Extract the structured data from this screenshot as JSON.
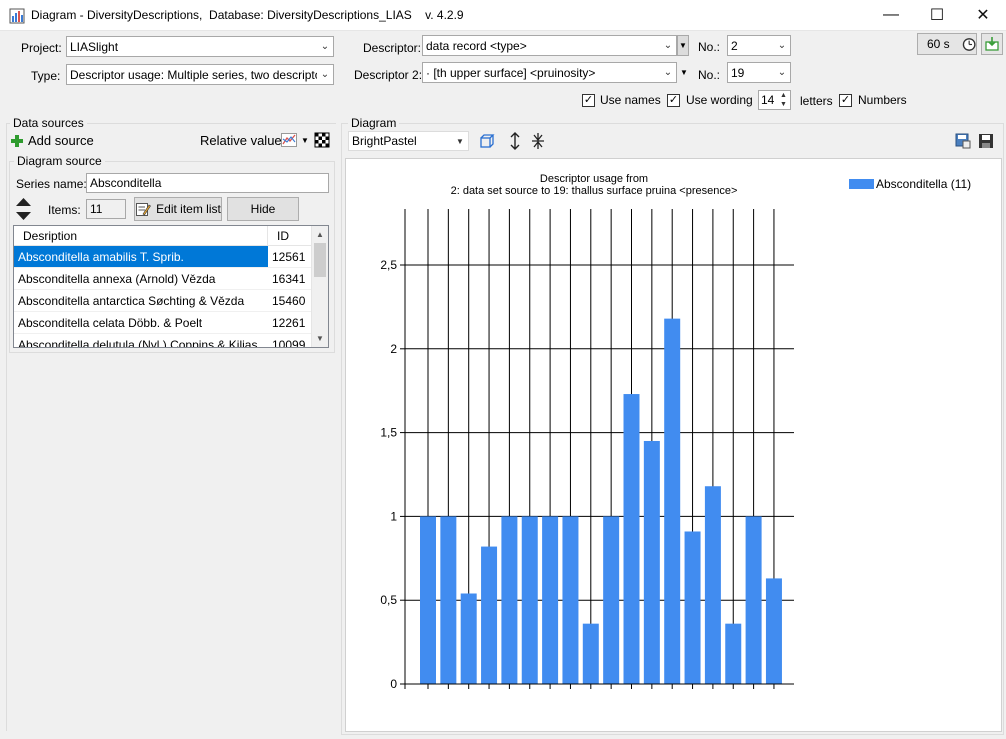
{
  "window": {
    "title": "Diagram - DiversityDescriptions,  Database: DiversityDescriptions_LIAS    v. 4.2.9",
    "minimize": "—",
    "maximize": "☐",
    "close": "✕"
  },
  "form": {
    "project_label": "Project:",
    "project_value": "LIASlight",
    "type_label": "Type:",
    "type_value": "Descriptor usage: Multiple series, two descriptors",
    "descriptor_label": "Descriptor:",
    "descriptor_value": "data record <type>",
    "descriptor2_label": "Descriptor 2:",
    "descriptor2_value": "·  [th upper surface] <pruinosity>",
    "no_label": "No.:",
    "no_value": "2",
    "no2_label": "No.:",
    "no2_value": "19",
    "timer_value": "60 s",
    "use_names_label": "Use names",
    "use_wording_label": "Use wording",
    "letters_value": "14",
    "letters_label": "letters",
    "numbers_label": "Numbers"
  },
  "data_sources": {
    "group_title": "Data sources",
    "add_source_label": "Add source",
    "relative_values_label": "Relative values",
    "diagram_source_title": "Diagram source",
    "series_name_label": "Series name:",
    "series_name_value": "Absconditella",
    "items_label": "Items:",
    "items_value": "11",
    "edit_item_list_label": "Edit item list",
    "hide_label": "Hide",
    "columns": [
      "Desription",
      "ID"
    ],
    "rows": [
      {
        "name": "Absconditella amabilis T. Sprib.",
        "id": "12561"
      },
      {
        "name": "Absconditella annexa (Arnold) Vězda",
        "id": "16341"
      },
      {
        "name": "Absconditella antarctica Søchting & Vězda",
        "id": "15460"
      },
      {
        "name": "Absconditella celata Döbb. & Poelt",
        "id": "12261"
      },
      {
        "name": "Absconditella delutula (Nyl.) Coppins & Kilias",
        "id": "10099"
      }
    ]
  },
  "diagram": {
    "group_title": "Diagram",
    "palette_value": "BrightPastel"
  },
  "colors": {
    "bar": "#418cf0",
    "selection": "#0078d7"
  },
  "chart_data": {
    "type": "bar",
    "title": "Descriptor usage from\n2: data set source to 19: thallus surface pruina <presence>",
    "title_line1": "Descriptor usage from",
    "title_line2": "2: data set source to 19: thallus surface pruina <presence>",
    "xlabel": "",
    "ylabel": "",
    "ylim": [
      0,
      2.85
    ],
    "yticks": [
      0,
      0.5,
      1,
      1.5,
      2,
      2.5
    ],
    "ytick_labels": [
      "0",
      "0,5",
      "1",
      "1,5",
      "2",
      "2,5"
    ],
    "grid": true,
    "legend": "top-right",
    "series": [
      {
        "name": "Absconditella (11)",
        "values": [
          1,
          1,
          0.54,
          0.82,
          1,
          1,
          1,
          1,
          0.36,
          1,
          1.73,
          1.45,
          2.18,
          0.91,
          1.18,
          0.36,
          1,
          0.63
        ]
      }
    ]
  }
}
